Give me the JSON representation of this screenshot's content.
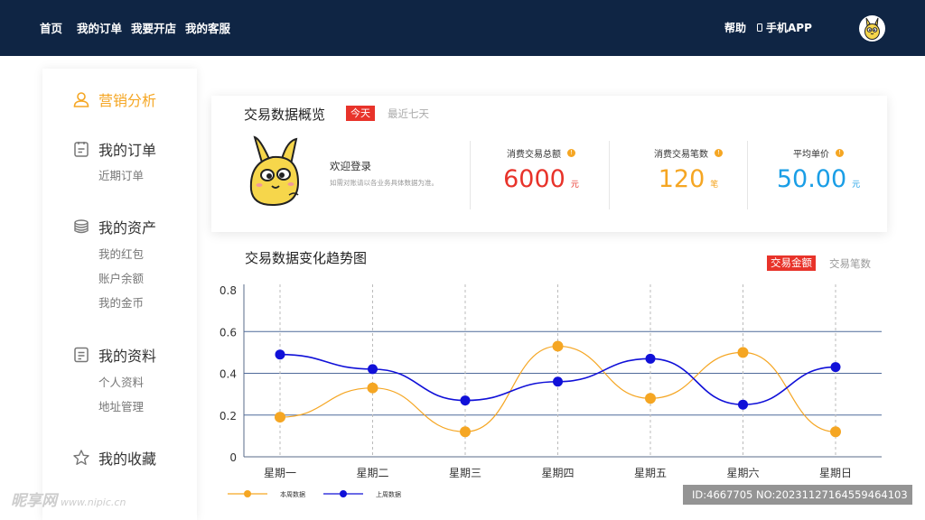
{
  "nav": {
    "home": "首页",
    "my_orders": "我的订单",
    "open_store": "我要开店",
    "customer_service": "我的客服",
    "help": "帮助",
    "mobile_app": "手机APP"
  },
  "sidebar": {
    "groups": [
      {
        "title": "营销分析",
        "icon": "user-icon",
        "active": true,
        "items": []
      },
      {
        "title": "我的订单",
        "icon": "clipboard-icon",
        "items": [
          "近期订单"
        ]
      },
      {
        "title": "我的资产",
        "icon": "coins-icon",
        "items": [
          "我的红包",
          "账户余额",
          "我的金币"
        ]
      },
      {
        "title": "我的资料",
        "icon": "document-icon",
        "items": [
          "个人资料",
          "地址管理"
        ]
      },
      {
        "title": "我的收藏",
        "icon": "star-icon",
        "items": []
      }
    ]
  },
  "overview": {
    "title": "交易数据概览",
    "tab_today": "今天",
    "tab_week": "最近七天",
    "welcome": "欢迎登录",
    "welcome_sub": "如需对账请以各业务具体数据为准。",
    "stats": [
      {
        "label": "消费交易总额",
        "value": "6000",
        "unit": "元",
        "color": "#e8332a"
      },
      {
        "label": "消费交易笔数",
        "value": "120",
        "unit": "笔",
        "color": "#f5a623"
      },
      {
        "label": "平均单价",
        "value": "50.00",
        "unit": "元",
        "color": "#1a9ee6"
      }
    ]
  },
  "trend": {
    "title": "交易数据变化趋势图",
    "tab_amount": "交易金额",
    "tab_count": "交易笔数"
  },
  "chart_data": {
    "type": "line",
    "categories": [
      "星期一",
      "星期二",
      "星期三",
      "星期四",
      "星期五",
      "星期六",
      "星期日"
    ],
    "y_ticks": [
      "0",
      "0.2",
      "0.4",
      "0.6",
      "0.8"
    ],
    "ylim": [
      0,
      0.8
    ],
    "smooth": true,
    "grid": "horizontal lines at 0.2, 0.4, 0.6; vertical dashed lines per category",
    "legend_position": "bottom-left",
    "series": [
      {
        "name": "本周数据",
        "color": "#f5a623",
        "values": [
          0.19,
          0.33,
          0.12,
          0.53,
          0.28,
          0.5,
          0.12
        ]
      },
      {
        "name": "上周数据",
        "color": "#1010d8",
        "values": [
          0.49,
          0.42,
          0.27,
          0.36,
          0.47,
          0.25,
          0.43
        ]
      }
    ]
  },
  "watermark": {
    "site": "昵享网",
    "url": "www.nipic.cn",
    "id_text": "ID:4667705 NO:20231127164559464103"
  }
}
